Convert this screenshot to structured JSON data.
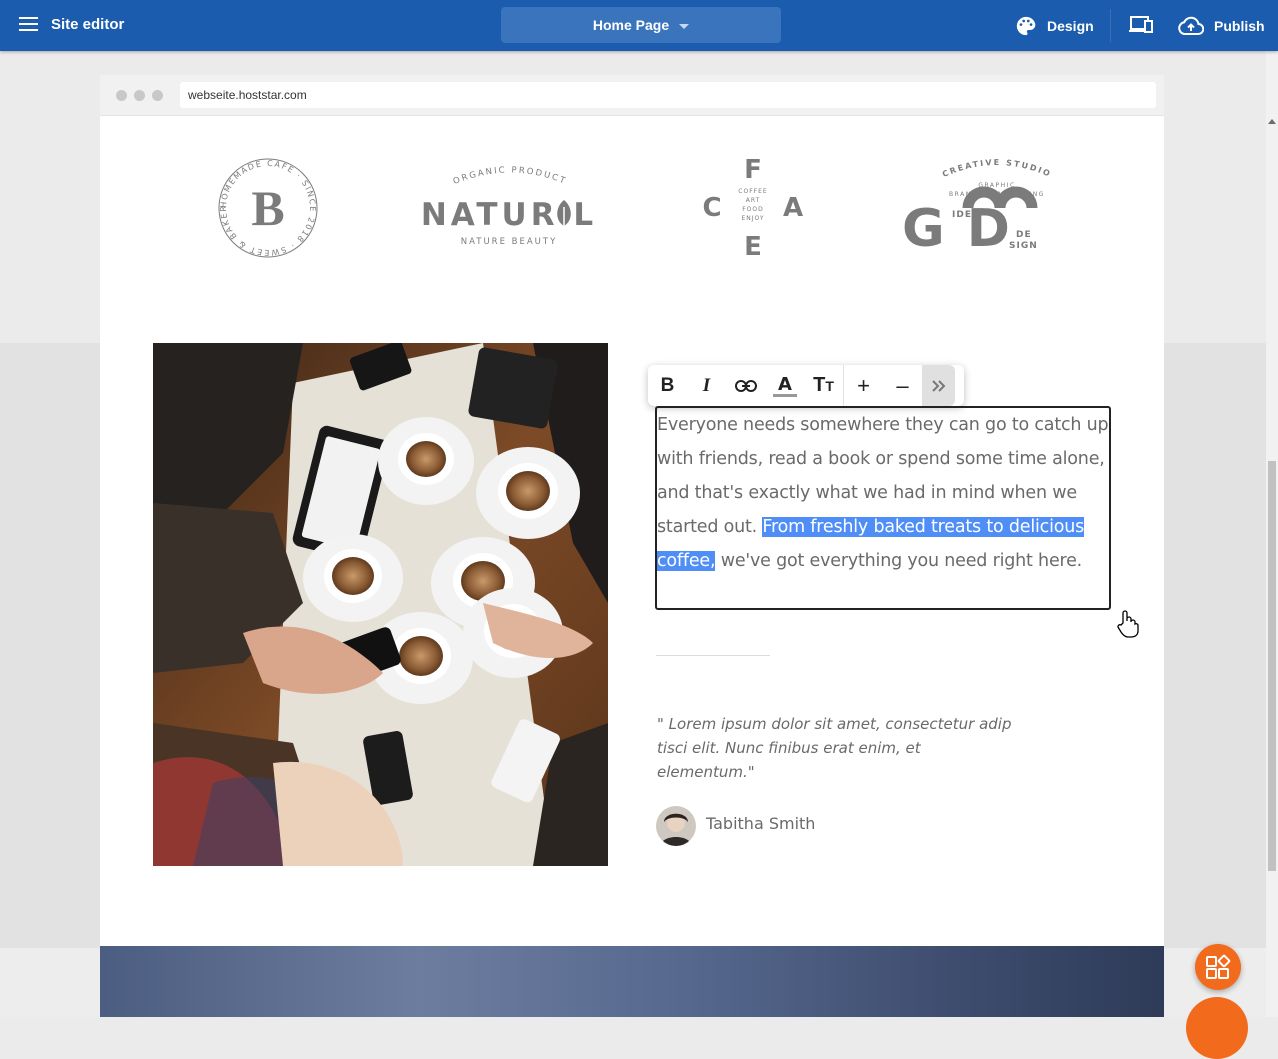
{
  "topbar": {
    "title": "Site editor",
    "page_select": "Home Page",
    "design_label": "Design",
    "publish_label": "Publish"
  },
  "browser": {
    "url": "webseite.hoststar.com"
  },
  "logos": {
    "bakery": {
      "letter": "B",
      "ring_text": "HOMEMADE CAFE · SINCE 2018 · SWEET & BAKERY"
    },
    "natural": {
      "top": "ORGANIC PRODUCT",
      "word": "NATUR L",
      "bottom": "NATURE BEAUTY"
    },
    "cafe": {
      "f": "F",
      "c": "C",
      "a": "A",
      "e": "E",
      "center": [
        "COFFEE",
        "ART",
        "FOOD",
        "ENJOY"
      ]
    },
    "good": {
      "top": "CREATIVE STUDIO",
      "mid": "GRAPHIC",
      "sub": "BRANDING·PACKAGING",
      "word": "G  D",
      "idea": "IDEA",
      "de": "DE",
      "sign": "SIGN"
    }
  },
  "content": {
    "paragraph_before": "Everyone needs somewhere they can go to catch up with friends, read a book or spend some time alone, and that's exactly what we had in mind when we started out. ",
    "paragraph_selected": "From freshly baked treats to delicious coffee,",
    "paragraph_after": " we've got everything you need right here.",
    "quote": "\" Lorem ipsum dolor sit amet, consectetur adip tisci elit. Nunc finibus erat enim, et elementum.\"",
    "author": "Tabitha Smith"
  },
  "toolbar": {
    "buttons": [
      "bold-icon",
      "italic-icon",
      "link-icon",
      "text-color-icon",
      "text-size-icon",
      "plus-icon",
      "minus-icon",
      "more-icon"
    ]
  },
  "colors": {
    "topbar": "#1b5cae",
    "selection": "#4f8ef7",
    "fab": "#f26a1b"
  }
}
